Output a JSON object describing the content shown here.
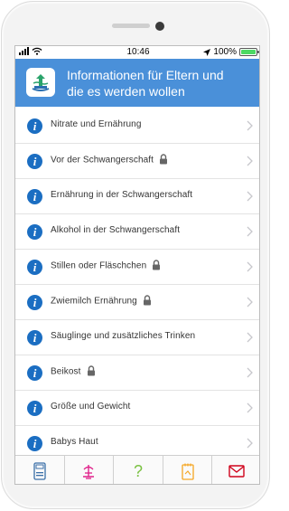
{
  "status": {
    "time": "10:46",
    "battery": "100%"
  },
  "header": {
    "title_line1": "Informationen für Eltern und",
    "title_line2": "die es werden wollen"
  },
  "list": [
    {
      "label": "Nitrate und Ernährung",
      "locked": false
    },
    {
      "label": "Vor der Schwangerschaft",
      "locked": true
    },
    {
      "label": "Ernährung in der Schwangerschaft",
      "locked": false
    },
    {
      "label": "Alkohol in der Schwangerschaft",
      "locked": false
    },
    {
      "label": "Stillen oder Fläschchen",
      "locked": true
    },
    {
      "label": "Zwiemilch Ernährung",
      "locked": true
    },
    {
      "label": "Säuglinge und zusätzliches Trinken",
      "locked": false
    },
    {
      "label": "Beikost",
      "locked": true
    },
    {
      "label": "Größe und Gewicht",
      "locked": false
    },
    {
      "label": "Babys Haut",
      "locked": false
    }
  ],
  "tabs": [
    {
      "icon": "calculator-icon",
      "color": "#3a6fa8"
    },
    {
      "icon": "fountain-icon",
      "color": "#e0218a"
    },
    {
      "icon": "question-icon",
      "color": "#7ac142",
      "glyph": "?"
    },
    {
      "icon": "notepad-icon",
      "color": "#f5a623"
    },
    {
      "icon": "mail-icon",
      "color": "#d0021b"
    }
  ],
  "colors": {
    "header": "#4a90d9",
    "info_icon": "#1b6ec2"
  }
}
